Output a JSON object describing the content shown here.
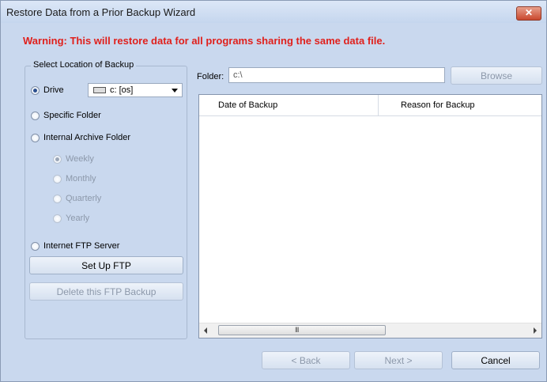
{
  "window": {
    "title": "Restore Data from a Prior Backup Wizard",
    "close_glyph": "✕"
  },
  "warning": "Warning:  This will restore data for all programs sharing the same data file.",
  "location_group": {
    "title": "Select Location of Backup",
    "drive_label": "Drive",
    "drive_value": "c: [os]",
    "specific_folder_label": "Specific Folder",
    "internal_archive_label": "Internal Archive Folder",
    "archive_options": [
      "Weekly",
      "Monthly",
      "Quarterly",
      "Yearly"
    ],
    "ftp_label": "Internet FTP Server",
    "setup_ftp_button": "Set Up FTP",
    "delete_ftp_button": "Delete this FTP Backup"
  },
  "folder": {
    "label": "Folder:",
    "value": "c:\\",
    "browse_button": "Browse"
  },
  "backup_list": {
    "columns": [
      "Date of Backup",
      "Reason for Backup"
    ],
    "rows": [],
    "scroll_grip": "III"
  },
  "nav": {
    "back_button": "< Back",
    "next_button": "Next >",
    "cancel_button": "Cancel"
  }
}
